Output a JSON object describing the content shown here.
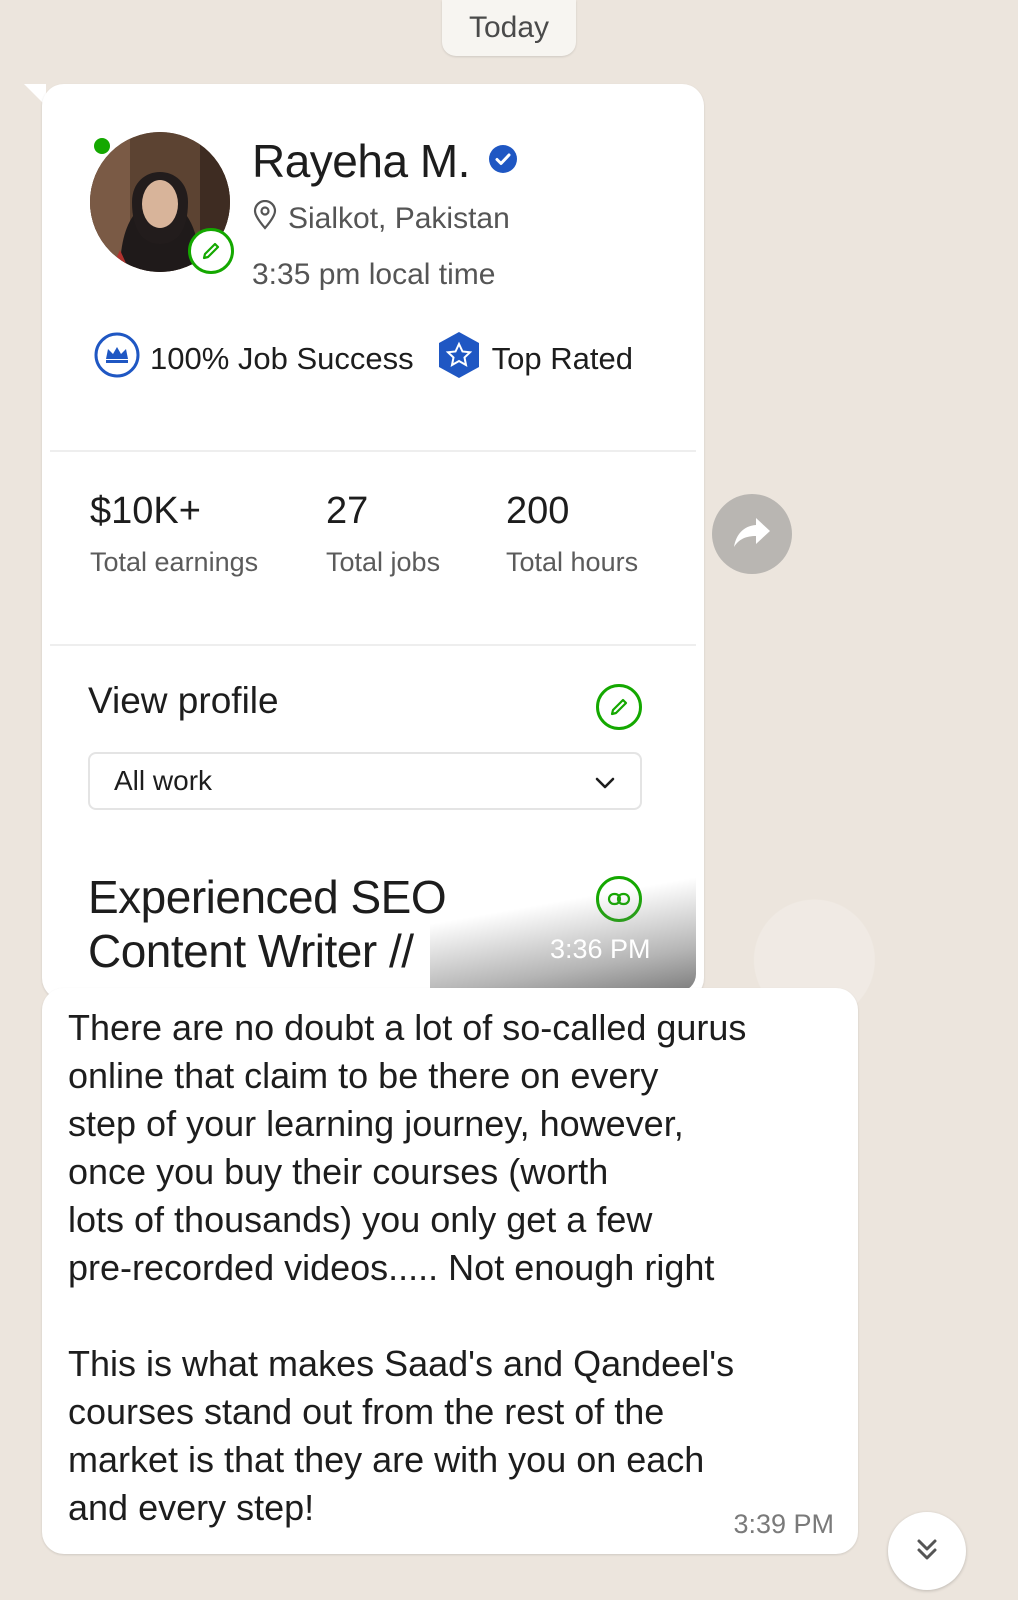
{
  "date_chip": "Today",
  "profile_card": {
    "name": "Rayeha M.",
    "location": "Sialkot, Pakistan",
    "local_time": "3:35 pm local time",
    "badges": {
      "job_success": "100% Job Success",
      "top_rated": "Top Rated"
    },
    "stats": [
      {
        "value": "$10K+",
        "label": "Total earnings"
      },
      {
        "value": "27",
        "label": "Total jobs"
      },
      {
        "value": "200",
        "label": "Total hours"
      }
    ],
    "view_profile": "View profile",
    "filter": {
      "selected": "All work"
    },
    "title_line1": "Experienced SEO",
    "title_line2": "Content Writer //",
    "time": "3:36 PM",
    "colors": {
      "brand_green": "#14a800",
      "verified_blue": "#1f57c3"
    }
  },
  "message": {
    "paragraph1": "There are no doubt a lot of so-called gurus\nonline that claim to be there on every\nstep of your learning journey,  however,\nonce you buy their courses (worth\nlots of thousands) you only get a few\npre-recorded videos..... Not enough right",
    "paragraph2": "This is what makes Saad's and Qandeel's\ncourses stand out from the rest of the\nmarket is that they are with you on each\nand every step!",
    "time": "3:39 PM"
  },
  "icons": {
    "forward": "forward-arrow-icon",
    "scroll": "double-chevron-down-icon"
  }
}
